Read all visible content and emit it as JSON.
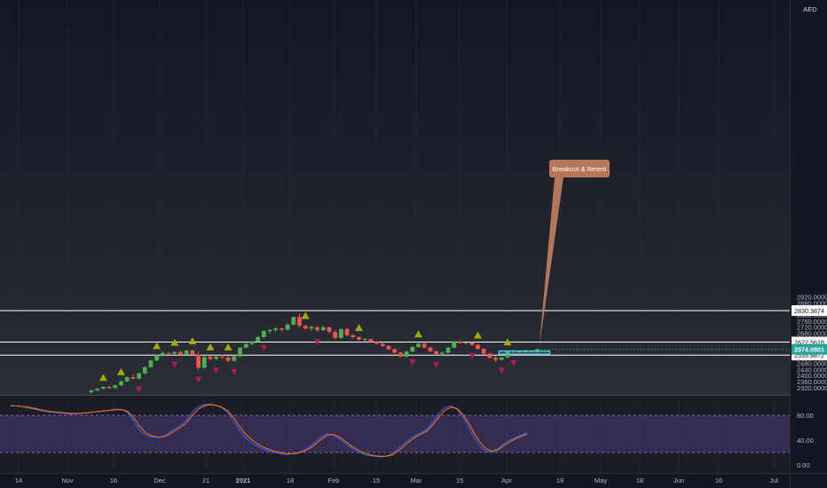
{
  "currency": "AED",
  "colors": {
    "up": "#4caf50",
    "down": "#ef5350",
    "signal_up": "#a8a800",
    "signal_down": "#b0185a",
    "grid": "#2a2e39",
    "hline": "#ffffff",
    "current_price_bg": "#26a69a",
    "callout_bg": "#b5765a",
    "box": "#4dd0e1",
    "stoch_k": "#2962ff",
    "stoch_d": "#ff6d00",
    "stoch_band": "#7e57c2"
  },
  "annotation": {
    "callout_text": "Breakout & Retest"
  },
  "chart_data": [
    {
      "type": "candlestick",
      "title": "",
      "ylim": [
        2300,
        2940
      ],
      "y_ticks": [
        2320,
        2360,
        2400,
        2440,
        2480,
        2520,
        2560,
        2600,
        2640,
        2680,
        2720,
        2760,
        2800,
        2840,
        2880,
        2920
      ],
      "x_ticks": [
        "14",
        "Nov",
        "16",
        "Dec",
        "21",
        "2021",
        "18",
        "Feb",
        "15",
        "Mar",
        "15",
        "Apr",
        "19",
        "May",
        "18",
        "Jun",
        "16",
        "Jul"
      ],
      "horizontal_lines": [
        {
          "value": 2830.3874,
          "label": "2830.3874"
        },
        {
          "value": 2622.5618,
          "label": "2622.5618"
        },
        {
          "value": 2535.8872,
          "label": "2535.8872"
        }
      ],
      "current_price": {
        "value": 2574.0801,
        "label": "2574.0801"
      },
      "candles": [
        {
          "o": 2290,
          "h": 2306,
          "l": 2284,
          "c": 2302
        },
        {
          "o": 2302,
          "h": 2318,
          "l": 2298,
          "c": 2313
        },
        {
          "o": 2313,
          "h": 2330,
          "l": 2309,
          "c": 2326
        },
        {
          "o": 2326,
          "h": 2332,
          "l": 2312,
          "c": 2318
        },
        {
          "o": 2318,
          "h": 2340,
          "l": 2315,
          "c": 2336
        },
        {
          "o": 2336,
          "h": 2368,
          "l": 2332,
          "c": 2362
        },
        {
          "o": 2362,
          "h": 2395,
          "l": 2358,
          "c": 2390
        },
        {
          "o": 2390,
          "h": 2410,
          "l": 2375,
          "c": 2380
        },
        {
          "o": 2380,
          "h": 2420,
          "l": 2376,
          "c": 2415
        },
        {
          "o": 2415,
          "h": 2462,
          "l": 2410,
          "c": 2456
        },
        {
          "o": 2456,
          "h": 2505,
          "l": 2450,
          "c": 2500
        },
        {
          "o": 2500,
          "h": 2540,
          "l": 2495,
          "c": 2535
        },
        {
          "o": 2535,
          "h": 2560,
          "l": 2525,
          "c": 2550
        },
        {
          "o": 2550,
          "h": 2558,
          "l": 2538,
          "c": 2545
        },
        {
          "o": 2545,
          "h": 2562,
          "l": 2540,
          "c": 2556
        },
        {
          "o": 2556,
          "h": 2568,
          "l": 2532,
          "c": 2538
        },
        {
          "o": 2538,
          "h": 2572,
          "l": 2535,
          "c": 2566
        },
        {
          "o": 2566,
          "h": 2572,
          "l": 2536,
          "c": 2540
        },
        {
          "o": 2540,
          "h": 2560,
          "l": 2440,
          "c": 2452
        },
        {
          "o": 2452,
          "h": 2530,
          "l": 2448,
          "c": 2524
        },
        {
          "o": 2524,
          "h": 2532,
          "l": 2500,
          "c": 2510
        },
        {
          "o": 2510,
          "h": 2530,
          "l": 2500,
          "c": 2525
        },
        {
          "o": 2525,
          "h": 2540,
          "l": 2510,
          "c": 2520
        },
        {
          "o": 2520,
          "h": 2532,
          "l": 2490,
          "c": 2498
        },
        {
          "o": 2498,
          "h": 2535,
          "l": 2492,
          "c": 2528
        },
        {
          "o": 2528,
          "h": 2590,
          "l": 2522,
          "c": 2585
        },
        {
          "o": 2585,
          "h": 2615,
          "l": 2580,
          "c": 2610
        },
        {
          "o": 2610,
          "h": 2632,
          "l": 2600,
          "c": 2626
        },
        {
          "o": 2626,
          "h": 2660,
          "l": 2620,
          "c": 2655
        },
        {
          "o": 2655,
          "h": 2700,
          "l": 2648,
          "c": 2695
        },
        {
          "o": 2695,
          "h": 2708,
          "l": 2680,
          "c": 2702
        },
        {
          "o": 2702,
          "h": 2720,
          "l": 2688,
          "c": 2712
        },
        {
          "o": 2712,
          "h": 2718,
          "l": 2690,
          "c": 2704
        },
        {
          "o": 2704,
          "h": 2745,
          "l": 2698,
          "c": 2738
        },
        {
          "o": 2738,
          "h": 2790,
          "l": 2732,
          "c": 2788
        },
        {
          "o": 2788,
          "h": 2810,
          "l": 2720,
          "c": 2730
        },
        {
          "o": 2730,
          "h": 2740,
          "l": 2700,
          "c": 2712
        },
        {
          "o": 2712,
          "h": 2730,
          "l": 2695,
          "c": 2722
        },
        {
          "o": 2722,
          "h": 2728,
          "l": 2690,
          "c": 2700
        },
        {
          "o": 2700,
          "h": 2730,
          "l": 2696,
          "c": 2720
        },
        {
          "o": 2720,
          "h": 2728,
          "l": 2680,
          "c": 2690
        },
        {
          "o": 2690,
          "h": 2700,
          "l": 2640,
          "c": 2650
        },
        {
          "o": 2650,
          "h": 2712,
          "l": 2645,
          "c": 2708
        },
        {
          "o": 2708,
          "h": 2715,
          "l": 2660,
          "c": 2668
        },
        {
          "o": 2668,
          "h": 2675,
          "l": 2645,
          "c": 2655
        },
        {
          "o": 2655,
          "h": 2660,
          "l": 2632,
          "c": 2638
        },
        {
          "o": 2638,
          "h": 2650,
          "l": 2625,
          "c": 2642
        },
        {
          "o": 2642,
          "h": 2646,
          "l": 2618,
          "c": 2624
        },
        {
          "o": 2624,
          "h": 2632,
          "l": 2605,
          "c": 2612
        },
        {
          "o": 2612,
          "h": 2618,
          "l": 2590,
          "c": 2596
        },
        {
          "o": 2596,
          "h": 2602,
          "l": 2568,
          "c": 2575
        },
        {
          "o": 2575,
          "h": 2580,
          "l": 2548,
          "c": 2552
        },
        {
          "o": 2552,
          "h": 2558,
          "l": 2520,
          "c": 2526
        },
        {
          "o": 2526,
          "h": 2565,
          "l": 2520,
          "c": 2560
        },
        {
          "o": 2560,
          "h": 2595,
          "l": 2555,
          "c": 2590
        },
        {
          "o": 2590,
          "h": 2618,
          "l": 2585,
          "c": 2612
        },
        {
          "o": 2612,
          "h": 2622,
          "l": 2580,
          "c": 2586
        },
        {
          "o": 2586,
          "h": 2592,
          "l": 2555,
          "c": 2562
        },
        {
          "o": 2562,
          "h": 2566,
          "l": 2538,
          "c": 2544
        },
        {
          "o": 2544,
          "h": 2560,
          "l": 2530,
          "c": 2552
        },
        {
          "o": 2552,
          "h": 2590,
          "l": 2548,
          "c": 2585
        },
        {
          "o": 2585,
          "h": 2632,
          "l": 2580,
          "c": 2626
        },
        {
          "o": 2626,
          "h": 2634,
          "l": 2610,
          "c": 2616
        },
        {
          "o": 2616,
          "h": 2630,
          "l": 2605,
          "c": 2620
        },
        {
          "o": 2620,
          "h": 2626,
          "l": 2598,
          "c": 2604
        },
        {
          "o": 2604,
          "h": 2610,
          "l": 2572,
          "c": 2578
        },
        {
          "o": 2578,
          "h": 2582,
          "l": 2540,
          "c": 2546
        },
        {
          "o": 2546,
          "h": 2550,
          "l": 2512,
          "c": 2518
        },
        {
          "o": 2518,
          "h": 2530,
          "l": 2490,
          "c": 2505
        },
        {
          "o": 2505,
          "h": 2525,
          "l": 2500,
          "c": 2520
        },
        {
          "o": 2520,
          "h": 2565,
          "l": 2515,
          "c": 2560
        },
        {
          "o": 2560,
          "h": 2572,
          "l": 2548,
          "c": 2565
        },
        {
          "o": 2565,
          "h": 2570,
          "l": 2548,
          "c": 2555
        },
        {
          "o": 2555,
          "h": 2572,
          "l": 2552,
          "c": 2566
        },
        {
          "o": 2566,
          "h": 2570,
          "l": 2550,
          "c": 2556
        },
        {
          "o": 2556,
          "h": 2580,
          "l": 2552,
          "c": 2574
        }
      ],
      "signals_up": [
        2,
        5,
        11,
        14,
        17,
        20,
        23,
        36,
        45,
        55,
        65,
        70
      ],
      "signals_down": [
        8,
        14,
        18,
        21,
        24,
        29,
        38,
        54,
        58,
        64,
        69,
        71
      ]
    },
    {
      "type": "line",
      "title": "",
      "ylim": [
        -5,
        105
      ],
      "y_ticks": [
        0,
        40,
        80
      ],
      "y_tick_labels": [
        "0.00",
        "40.00",
        "80.00"
      ],
      "band": [
        20,
        80
      ],
      "series": [
        {
          "name": "",
          "values": [
            96,
            95,
            94,
            92,
            90,
            88,
            86,
            85,
            84,
            83,
            82,
            82,
            83,
            84,
            85,
            86,
            87,
            88,
            90,
            89,
            84,
            70,
            55,
            48,
            45,
            44,
            46,
            52,
            58,
            64,
            72,
            86,
            94,
            97,
            98,
            96,
            92,
            84,
            70,
            56,
            44,
            36,
            30,
            26,
            22,
            20,
            18,
            17,
            18,
            20,
            24,
            30,
            38,
            46,
            50,
            48,
            42,
            34,
            28,
            22,
            18,
            15,
            14,
            13,
            14,
            18,
            26,
            34,
            42,
            48,
            52,
            58,
            70,
            84,
            92,
            95,
            90,
            78,
            62,
            44,
            30,
            22,
            20,
            26,
            34,
            40,
            44,
            48,
            52
          ]
        },
        {
          "name": "",
          "values": [
            95,
            95,
            94,
            93,
            91,
            89,
            87,
            86,
            85,
            84,
            83,
            83,
            83,
            84,
            85,
            86,
            87,
            88,
            89,
            89,
            86,
            76,
            62,
            52,
            47,
            45,
            45,
            49,
            55,
            61,
            68,
            80,
            90,
            95,
            97,
            96,
            93,
            87,
            76,
            62,
            50,
            41,
            34,
            29,
            25,
            22,
            20,
            18,
            18,
            19,
            22,
            27,
            34,
            42,
            48,
            49,
            45,
            38,
            31,
            25,
            20,
            17,
            15,
            14,
            14,
            16,
            22,
            30,
            38,
            45,
            50,
            55,
            65,
            78,
            88,
            93,
            91,
            82,
            68,
            51,
            36,
            26,
            22,
            24,
            31,
            37,
            42,
            46,
            50
          ]
        }
      ]
    }
  ]
}
